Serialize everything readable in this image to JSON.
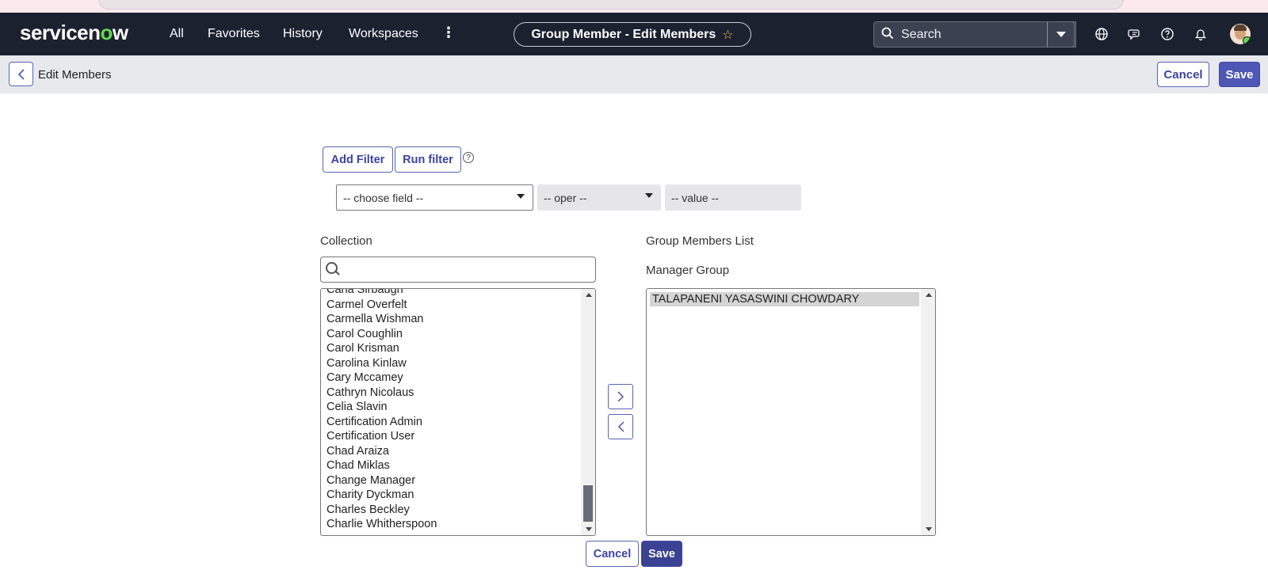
{
  "header": {
    "logo_left": "servicen",
    "logo_accent": "o",
    "logo_right": "w",
    "nav": [
      "All",
      "Favorites",
      "History",
      "Workspaces"
    ],
    "context_title": "Group Member - Edit Members",
    "search_placeholder": "Search"
  },
  "titlebar": {
    "title": "Edit Members",
    "cancel_label": "Cancel",
    "save_label": "Save"
  },
  "filter": {
    "add_filter_label": "Add Filter",
    "run_filter_label": "Run filter",
    "help_glyph": "?",
    "field_placeholder": "-- choose field --",
    "oper_placeholder": "-- oper --",
    "value_placeholder": "-- value --"
  },
  "collection": {
    "label": "Collection",
    "items": [
      "Carla Sirbaugh",
      "Carmel Overfelt",
      "Carmella Wishman",
      "Carol Coughlin",
      "Carol Krisman",
      "Carolina Kinlaw",
      "Cary Mccamey",
      "Cathryn Nicolaus",
      "Celia Slavin",
      "Certification Admin",
      "Certification User",
      "Chad Araiza",
      "Chad Miklas",
      "Change Manager",
      "Charity Dyckman",
      "Charles Beckley",
      "Charlie Whitherspoon"
    ]
  },
  "members": {
    "label": "Group Members List",
    "group_label": "Manager Group",
    "items": [
      "TALAPANENI YASASWINI CHOWDARY"
    ]
  },
  "footer": {
    "cancel_label": "Cancel",
    "save_label": "Save"
  },
  "colors": {
    "header_bg": "#1c2130",
    "accent": "#4e57b6",
    "logo_green": "#62d84e"
  }
}
